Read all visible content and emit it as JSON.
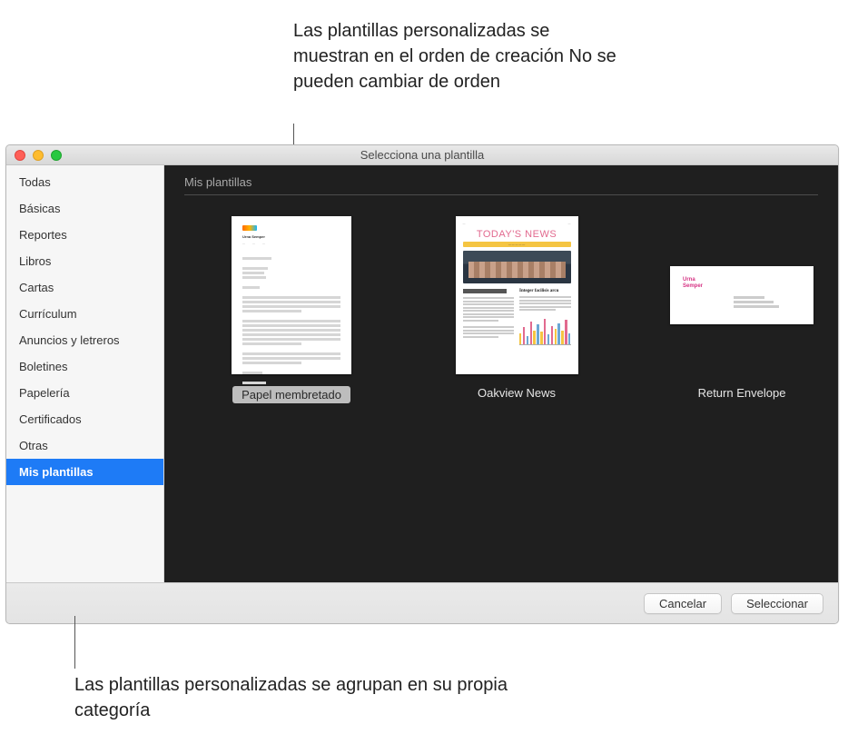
{
  "callouts": {
    "top": "Las plantillas personalizadas se muestran en el orden de creación No se pueden cambiar de orden",
    "bottom": "Las plantillas personalizadas se agrupan en su propia categoría"
  },
  "window": {
    "title": "Selecciona una plantilla"
  },
  "sidebar": {
    "items": [
      {
        "label": "Todas",
        "selected": false
      },
      {
        "label": "Básicas",
        "selected": false
      },
      {
        "label": "Reportes",
        "selected": false
      },
      {
        "label": "Libros",
        "selected": false
      },
      {
        "label": "Cartas",
        "selected": false
      },
      {
        "label": "Currículum",
        "selected": false
      },
      {
        "label": "Anuncios y letreros",
        "selected": false
      },
      {
        "label": "Boletines",
        "selected": false
      },
      {
        "label": "Papelería",
        "selected": false
      },
      {
        "label": "Certificados",
        "selected": false
      },
      {
        "label": "Otras",
        "selected": false
      },
      {
        "label": "Mis plantillas",
        "selected": true
      }
    ]
  },
  "content": {
    "section_header": "Mis plantillas",
    "templates": [
      {
        "label": "Papel membretado",
        "kind": "letter",
        "editing": true
      },
      {
        "label": "Oakview News",
        "kind": "news",
        "editing": false
      },
      {
        "label": "Return Envelope",
        "kind": "envelope",
        "editing": false
      }
    ],
    "news_preview": {
      "masthead": "TODAY'S NEWS",
      "headline": "Integer facilisis arcu"
    },
    "envelope_preview": {
      "from_line1": "Urna",
      "from_line2": "Semper"
    }
  },
  "footer": {
    "cancel": "Cancelar",
    "select": "Seleccionar"
  }
}
